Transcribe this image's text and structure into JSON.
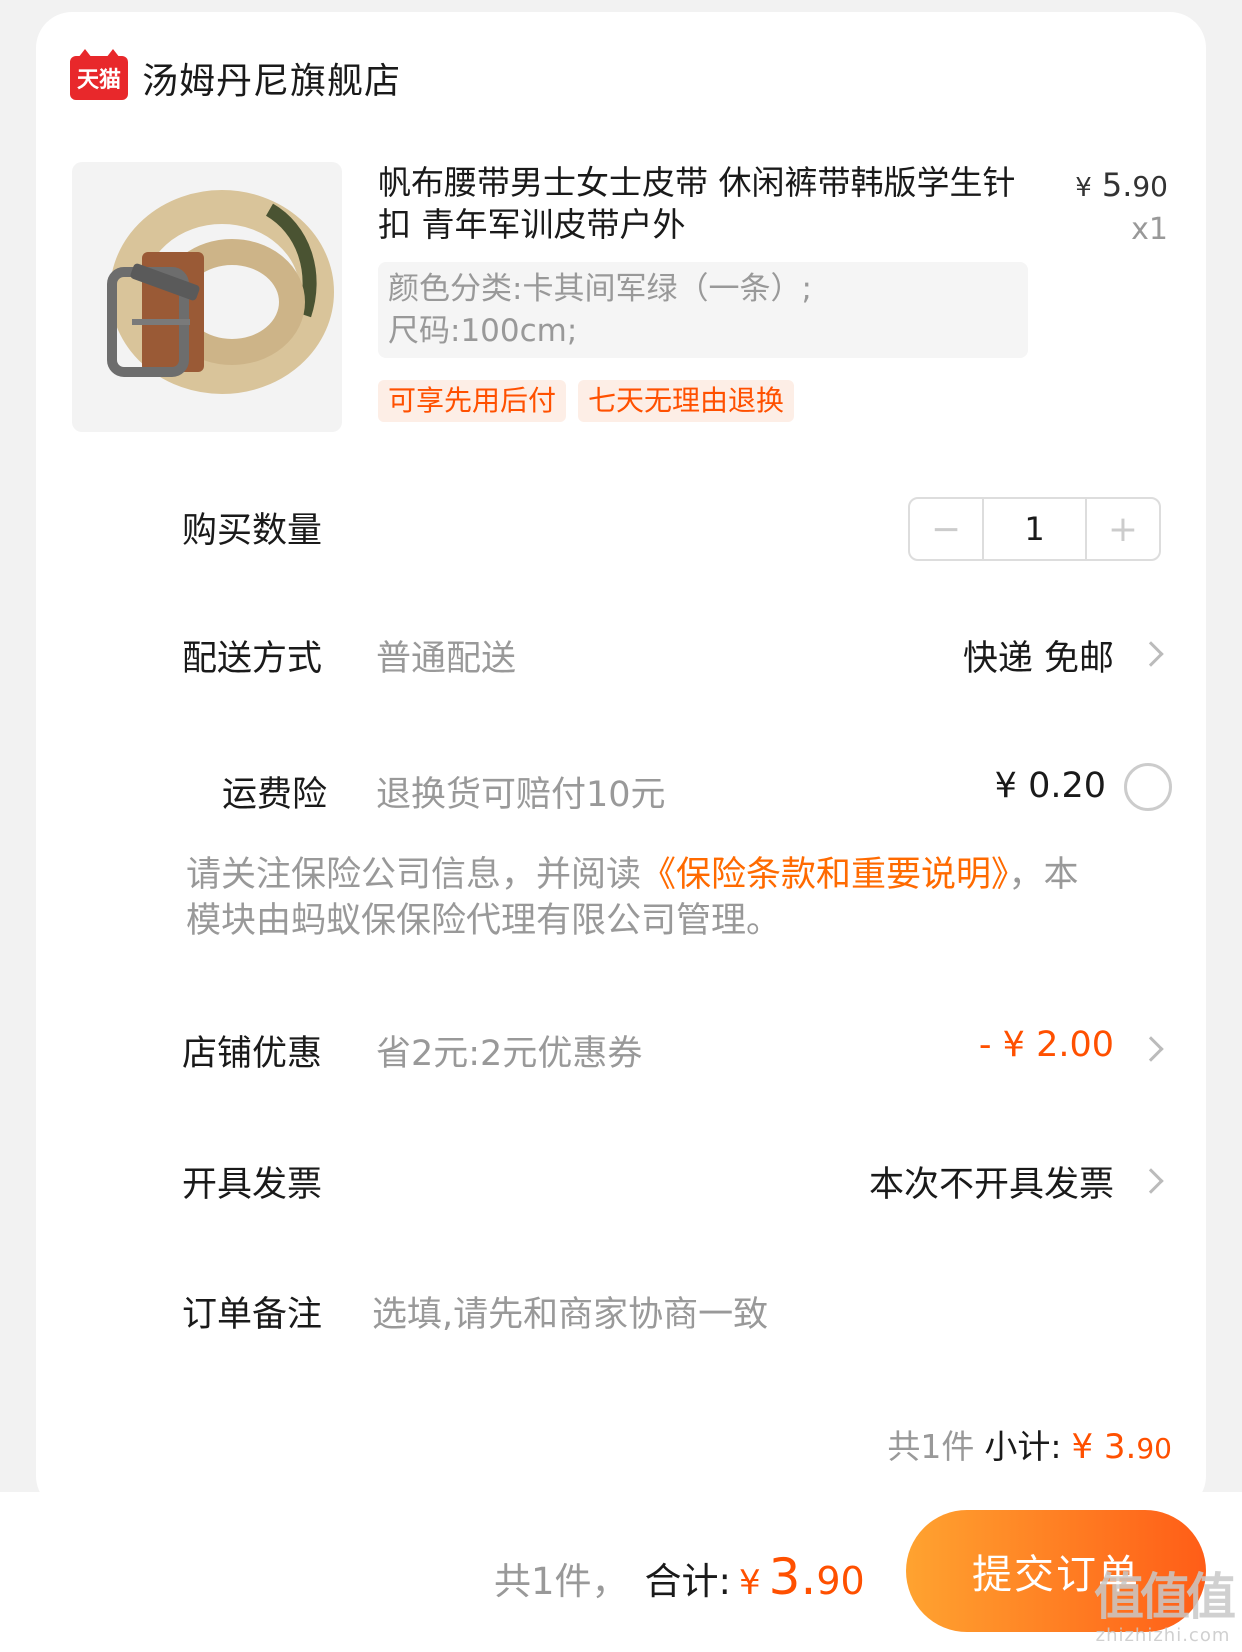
{
  "store": {
    "badge": "天猫",
    "name": "汤姆丹尼旗舰店"
  },
  "product": {
    "image_icon": "canvas-belt-product-image",
    "title": "帆布腰带男士女士皮带 休闲裤带韩版学生针扣 青年军训皮带户外",
    "price_currency": "¥",
    "price_int": "5.",
    "price_dec": "90",
    "quantity": "x1",
    "sku_color": "颜色分类:卡其间军绿（一条）;",
    "sku_size": "尺码:100cm;",
    "tags": [
      "可享先用后付",
      "七天无理由退换"
    ]
  },
  "quantity_row": {
    "label": "购买数量",
    "minus": "−",
    "value": "1",
    "plus": "+"
  },
  "delivery": {
    "label": "配送方式",
    "sub": "普通配送",
    "value": "快递 免邮"
  },
  "insurance": {
    "label": "运费险",
    "sub": "退换货可赔付10元",
    "value": "¥ 0.20",
    "notice_pre": "请关注保险公司信息，并阅读",
    "notice_link": "《保险条款和重要说明》",
    "notice_post": "，本模块由蚂蚁保保险代理有限公司管理。"
  },
  "coupon": {
    "label": "店铺优惠",
    "sub": "省2元:2元优惠券",
    "value": "- ¥ 2.00"
  },
  "invoice": {
    "label": "开具发票",
    "value": "本次不开具发票"
  },
  "remark": {
    "label": "订单备注",
    "placeholder": "选填,请先和商家协商一致"
  },
  "subtotal": {
    "count": "共1件",
    "label": "小计:",
    "currency": "¥",
    "int": "3.",
    "dec": "90"
  },
  "footer": {
    "count": "共1件，",
    "label": "合计:",
    "currency": "¥",
    "int": "3.",
    "dec": "90",
    "submit": "提交订单"
  },
  "watermark": {
    "big": "值值值",
    "small": "zhizhizhi.com"
  },
  "colors": {
    "accent": "#ff5000",
    "brand_red": "#e8282b",
    "button_start": "#ffa330",
    "button_end": "#ff5d17"
  }
}
